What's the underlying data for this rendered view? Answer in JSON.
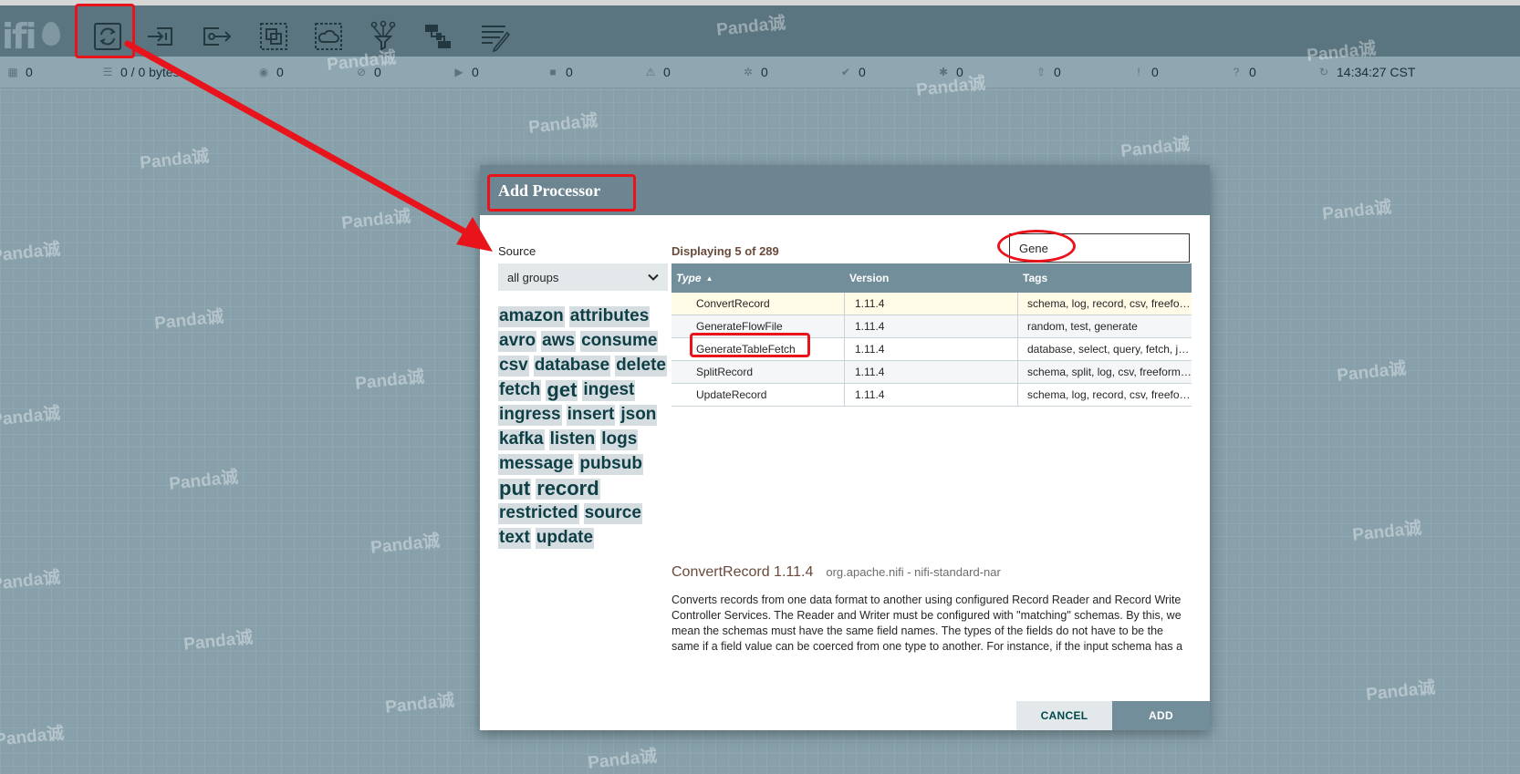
{
  "app": {
    "logo_text": "ifi"
  },
  "toolbar": {
    "tools": [
      {
        "icon": "processor-icon"
      },
      {
        "icon": "input-port-icon"
      },
      {
        "icon": "output-port-icon"
      },
      {
        "icon": "process-group-icon"
      },
      {
        "icon": "remote-process-group-icon"
      },
      {
        "icon": "funnel-icon"
      },
      {
        "icon": "template-icon"
      },
      {
        "icon": "label-icon"
      }
    ]
  },
  "status": {
    "threads": "0",
    "queued": "0 / 0 bytes",
    "transmitting": "0",
    "not_transmitting": "0",
    "running": "0",
    "stopped": "0",
    "invalid": "0",
    "disabled": "0",
    "up_to_date": "0",
    "locally_modified": "0",
    "stale": "0",
    "modified_stale": "0",
    "sync_failure": "0",
    "refresh_time": "14:34:27 CST"
  },
  "watermark": "Panda诚",
  "dialog": {
    "title": "Add Processor",
    "source_label": "Source",
    "source_value": "all groups",
    "tags": [
      "amazon",
      "attributes",
      "avro",
      "aws",
      "consume",
      "csv",
      "database",
      "delete",
      "fetch",
      "get",
      "ingest",
      "ingress",
      "insert",
      "json",
      "kafka",
      "listen",
      "logs",
      "message",
      "pubsub",
      "put",
      "record",
      "restricted",
      "source",
      "text",
      "update"
    ],
    "displaying": "Displaying 5 of 289",
    "filter_value": "Gene",
    "columns": {
      "type": "Type",
      "version": "Version",
      "tags": "Tags"
    },
    "rows": [
      {
        "type": "ConvertRecord",
        "version": "1.11.4",
        "tags": "schema, log, record, csv, freeform, json, text"
      },
      {
        "type": "GenerateFlowFile",
        "version": "1.11.4",
        "tags": "random, test, generate"
      },
      {
        "type": "GenerateTableFetch",
        "version": "1.11.4",
        "tags": "database, select, query, fetch, jdbc, sql"
      },
      {
        "type": "SplitRecord",
        "version": "1.11.4",
        "tags": "schema, split, log, csv, freeform, generic"
      },
      {
        "type": "UpdateRecord",
        "version": "1.11.4",
        "tags": "schema, log, record, csv, freeform, json"
      }
    ],
    "selected": {
      "name": "ConvertRecord 1.11.4",
      "bundle": "org.apache.nifi - nifi-standard-nar",
      "description": "Converts records from one data format to another using configured Record Reader and Record Write Controller Services. The Reader and Writer must be configured with \"matching\" schemas. By this, we mean the schemas must have the same field names. The types of the fields do not have to be the same if a field value can be coerced from one type to another. For instance, if the input schema has a field named \"balance\" of type double, the output schema can have a field named \"balance\" with a type of string, double, or float."
    },
    "cancel_label": "CANCEL",
    "add_label": "ADD"
  },
  "colors": {
    "canvas": "#87a0aa",
    "toolbar": "#5b7580",
    "header": "#6c8590",
    "annotation": "#e8131b",
    "title_text": "#6a4b3c"
  }
}
